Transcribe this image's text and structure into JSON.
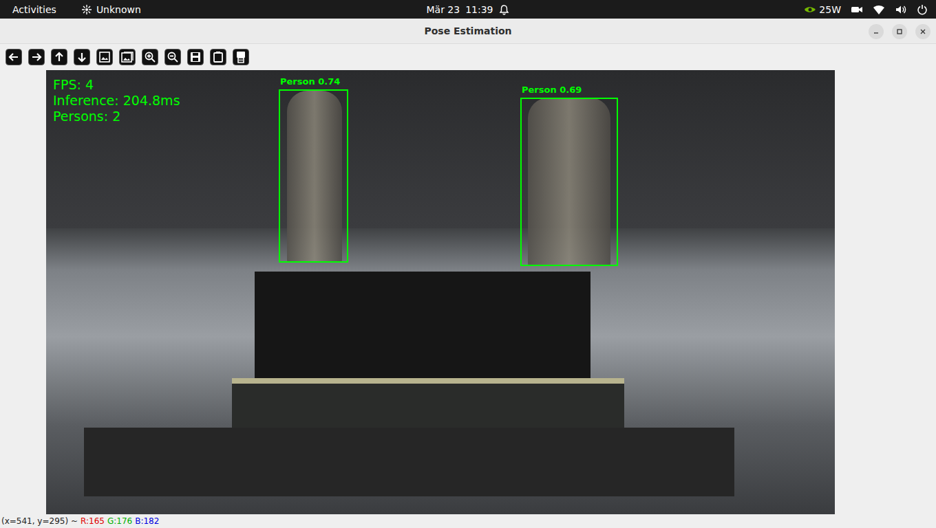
{
  "topbar": {
    "activities": "Activities",
    "app": "Unknown",
    "date": "Mär 23",
    "time": "11:39",
    "power": "25W"
  },
  "window": {
    "title": "Pose Estimation"
  },
  "frame": {
    "overlay": {
      "fps": "FPS: 4",
      "inference": "Inference: 204.8ms",
      "persons": "Persons: 2"
    },
    "detections": [
      {
        "label": "Person 0.74"
      },
      {
        "label": "Person 0.69"
      }
    ]
  },
  "status_bar": {
    "coords": "(x=541, y=295) ~",
    "r": "R:165",
    "g": "G:176",
    "b": "B:182"
  }
}
